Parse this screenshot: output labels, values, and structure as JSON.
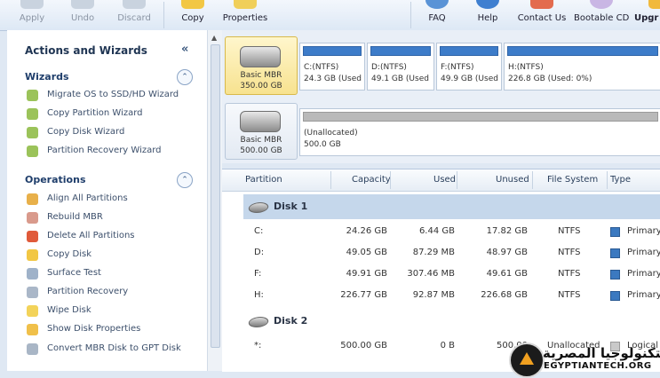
{
  "toolbar": {
    "buttons": [
      {
        "label": "Apply",
        "icon": "apply-check-icon",
        "enabled": false
      },
      {
        "label": "Undo",
        "icon": "undo-arrow-icon",
        "enabled": false
      },
      {
        "label": "Discard",
        "icon": "discard-x-icon",
        "enabled": false
      },
      {
        "label": "Copy",
        "icon": "copy-disk-icon",
        "enabled": true
      },
      {
        "label": "Properties",
        "icon": "properties-icon",
        "enabled": true
      },
      {
        "label": "FAQ",
        "icon": "faq-icon",
        "enabled": true
      },
      {
        "label": "Help",
        "icon": "help-icon",
        "enabled": true
      },
      {
        "label": "Contact Us",
        "icon": "contact-icon",
        "enabled": true
      },
      {
        "label": "Bootable CD",
        "icon": "bootable-cd-icon",
        "enabled": true
      },
      {
        "label": "Upgr",
        "icon": "upgrade-icon",
        "enabled": true
      }
    ]
  },
  "sidebar": {
    "title": "Actions and Wizards",
    "collapse_glyph": "«",
    "wizards": {
      "title": "Wizards",
      "toggle": "⌃",
      "items": [
        {
          "label": "Migrate OS to SSD/HD Wizard",
          "icon": "migrate-os-icon"
        },
        {
          "label": "Copy Partition Wizard",
          "icon": "copy-partition-icon"
        },
        {
          "label": "Copy Disk Wizard",
          "icon": "copy-disk-icon"
        },
        {
          "label": "Partition Recovery Wizard",
          "icon": "partition-recovery-icon"
        }
      ]
    },
    "operations": {
      "title": "Operations",
      "toggle": "⌃",
      "items": [
        {
          "label": "Align All Partitions",
          "icon": "align-icon"
        },
        {
          "label": "Rebuild MBR",
          "icon": "rebuild-mbr-icon"
        },
        {
          "label": "Delete All Partitions",
          "icon": "delete-icon"
        },
        {
          "label": "Copy Disk",
          "icon": "copy-disk-icon"
        },
        {
          "label": "Surface Test",
          "icon": "surface-test-icon"
        },
        {
          "label": "Partition Recovery",
          "icon": "partition-recovery-icon"
        },
        {
          "label": "Wipe Disk",
          "icon": "wipe-disk-icon"
        },
        {
          "label": "Show Disk Properties",
          "icon": "disk-properties-icon"
        },
        {
          "label": "Convert MBR Disk to GPT Disk",
          "icon": "convert-gpt-icon"
        }
      ]
    }
  },
  "disk_map": {
    "disks": [
      {
        "line1": "Basic MBR",
        "line2": "350.00 GB",
        "selected": true,
        "partitions": [
          {
            "line1": "C:(NTFS)",
            "line2": "24.3 GB (Used",
            "bar": "blue"
          },
          {
            "line1": "D:(NTFS)",
            "line2": "49.1 GB (Used",
            "bar": "blue"
          },
          {
            "line1": "F:(NTFS)",
            "line2": "49.9 GB (Used",
            "bar": "blue"
          },
          {
            "line1": "H:(NTFS)",
            "line2": "226.8 GB (Used: 0%)",
            "bar": "blue"
          }
        ]
      },
      {
        "line1": "Basic MBR",
        "line2": "500.00 GB",
        "selected": false,
        "partitions": [
          {
            "line1": "(Unallocated)",
            "line2": "500.0 GB",
            "bar": "gray"
          }
        ]
      }
    ]
  },
  "table": {
    "headers": [
      "Partition",
      "Capacity",
      "Used",
      "Unused",
      "File System",
      "Type"
    ],
    "disk1_label": "Disk 1",
    "disk2_label": "Disk 2",
    "disk1_rows": [
      {
        "partition": "C:",
        "capacity": "24.26 GB",
        "used": "6.44 GB",
        "unused": "17.82 GB",
        "fs": "NTFS",
        "type": "Primary"
      },
      {
        "partition": "D:",
        "capacity": "49.05 GB",
        "used": "87.29 MB",
        "unused": "48.97 GB",
        "fs": "NTFS",
        "type": "Primary"
      },
      {
        "partition": "F:",
        "capacity": "49.91 GB",
        "used": "307.46 MB",
        "unused": "49.61 GB",
        "fs": "NTFS",
        "type": "Primary"
      },
      {
        "partition": "H:",
        "capacity": "226.77 GB",
        "used": "92.87 MB",
        "unused": "226.68 GB",
        "fs": "NTFS",
        "type": "Primary"
      }
    ],
    "disk2_rows": [
      {
        "partition": "*:",
        "capacity": "500.00 GB",
        "used": "0 B",
        "unused": "500.00",
        "fs": "Unallocated",
        "type": "Logical"
      }
    ]
  },
  "watermark": {
    "arabic": "التكنولوجيا المصرية",
    "english": "EGYPTIANTECH.ORG"
  },
  "colors": {
    "accent_blue": "#3d7cc9",
    "selected_disk": "#f7e28f",
    "selected_row": "#c5d7eb"
  }
}
